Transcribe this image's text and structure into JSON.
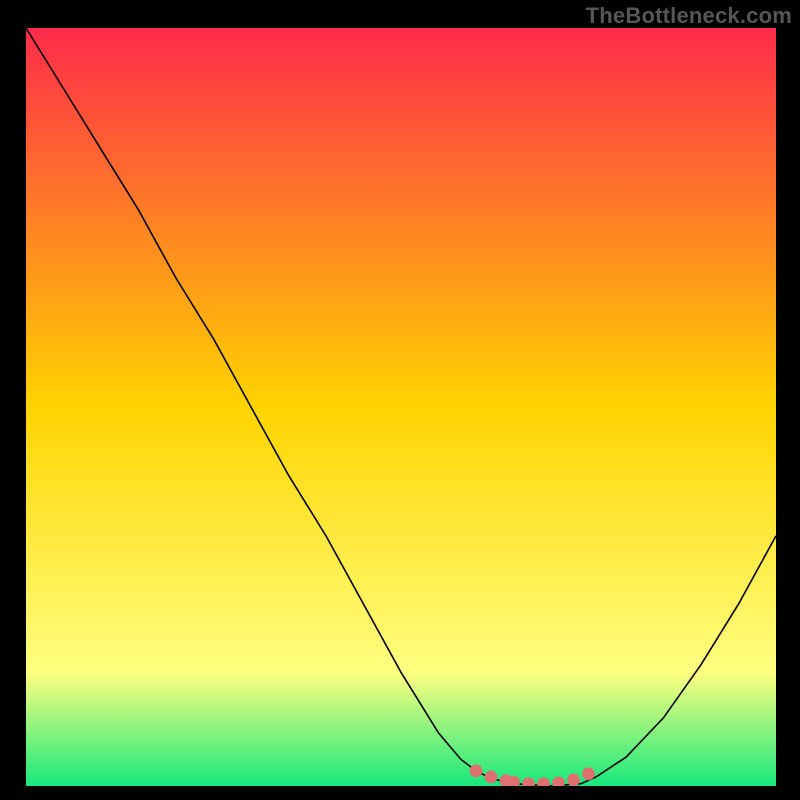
{
  "attribution": "TheBottleneck.com",
  "colors": {
    "frame": "#000000",
    "gradient_top": "#ff2b4a",
    "gradient_mid": "#ffd400",
    "gradient_low": "#ffff80",
    "gradient_bottom": "#17e87c",
    "curve": "#000000",
    "marker": "#de7070",
    "attribution_text": "#565656"
  },
  "chart_data": {
    "type": "line",
    "title": "",
    "xlabel": "",
    "ylabel": "",
    "xlim": [
      0,
      100
    ],
    "ylim": [
      0,
      100
    ],
    "series": [
      {
        "name": "curve",
        "x": [
          0,
          5,
          10,
          15,
          20,
          25,
          30,
          35,
          40,
          45,
          50,
          55,
          58,
          60,
          62,
          65,
          70,
          74,
          76,
          80,
          85,
          90,
          95,
          100
        ],
        "y": [
          100,
          92,
          84,
          76,
          67,
          59,
          50,
          41,
          33,
          24,
          15,
          7,
          3.5,
          2,
          1,
          0.3,
          0,
          0.3,
          1.2,
          3.8,
          9,
          16,
          24,
          33
        ]
      }
    ],
    "markers": {
      "name": "sweet-spot",
      "x": [
        60,
        62,
        64,
        65,
        67,
        69,
        71,
        73,
        75
      ],
      "y": [
        2.0,
        1.2,
        0.7,
        0.5,
        0.3,
        0.3,
        0.4,
        0.8,
        1.6
      ]
    }
  }
}
